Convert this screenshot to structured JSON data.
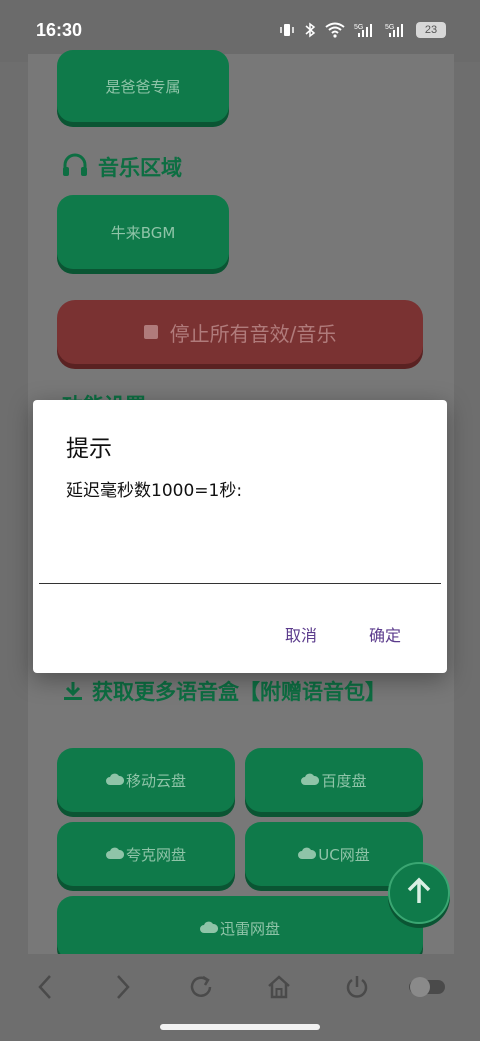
{
  "status_bar": {
    "time": "16:30",
    "battery": "23",
    "icons": [
      "vibrate-icon",
      "bluetooth-icon",
      "wifi-icon",
      "signal-5g-icon",
      "signal-5g-icon"
    ]
  },
  "page": {
    "buttons_top": [
      {
        "label": "是爸爸专属"
      }
    ],
    "music_section": {
      "heading": "音乐区域",
      "icon": "headphones-icon",
      "buttons": [
        {
          "label": "牛来BGM"
        }
      ]
    },
    "stop_button": {
      "label": "停止所有音效/音乐"
    },
    "partial_heading": "功能设置",
    "download_section": {
      "heading": "获取更多语音盒【附赠语音包】",
      "icon": "download-icon",
      "buttons": [
        {
          "label": "移动云盘"
        },
        {
          "label": "百度盘"
        },
        {
          "label": "夸克网盘"
        },
        {
          "label": "UC网盘"
        },
        {
          "label": "迅雷网盘"
        }
      ]
    }
  },
  "dialog": {
    "title": "提示",
    "message": "延迟毫秒数1000=1秒:",
    "input_value": "",
    "cancel_label": "取消",
    "ok_label": "确定"
  },
  "colors": {
    "accent_green": "#0f7a4a",
    "dialog_button": "#5b3b8c"
  }
}
